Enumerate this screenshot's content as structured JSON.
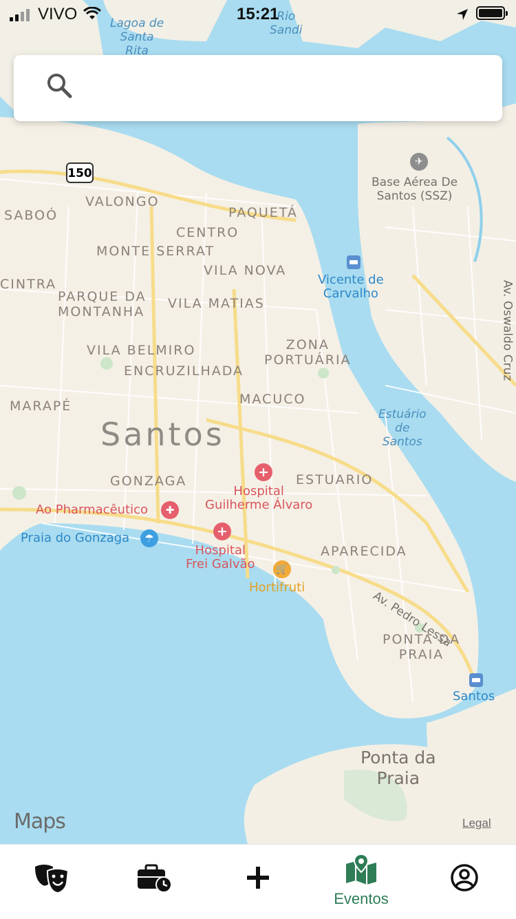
{
  "status_bar": {
    "carrier": "VIVO",
    "time": "15:21"
  },
  "search": {
    "placeholder": "",
    "value": ""
  },
  "map": {
    "city_label": "Santos",
    "route_shield": "150",
    "districts": [
      "VALONGO",
      "SABOÓ",
      "PAQUETÁ",
      "CENTRO",
      "MONTE SERRAT",
      "VILA NOVA",
      "CINTRA",
      "PARQUE DA",
      "MONTANHA",
      "VILA MATIAS",
      "VILA BELMIRO",
      "ZONA",
      "PORTUÁRIA",
      "ENCRUZILHADA",
      "MARAPÉ",
      "MACUCO",
      "GONZAGA",
      "ESTUARIO",
      "APARECIDA",
      "PONTA DA",
      "PRAIA"
    ],
    "water": [
      "Lagoa de",
      "Santa",
      "Rita",
      "Rio",
      "Sandi",
      "Estuário",
      "de",
      "Santos"
    ],
    "airbase": [
      "Base Aérea De",
      "Santos (SSZ)"
    ],
    "ferry_1": [
      "Vicente de",
      "Carvalho"
    ],
    "ferry_2": "Santos",
    "street_1": "Av. Oswaldo Cruz",
    "street_2": "Av. Pedro Lessa",
    "hospital_1": [
      "Hospital",
      "Guilherme Álvaro"
    ],
    "hospital_2": [
      "Hospital",
      "Frei Galvão"
    ],
    "pharmacy": "Ao Pharmacêutico",
    "beach": "Praia do Gonzaga",
    "market": "Hortifruti",
    "island": [
      "Ponta da",
      "Praia"
    ],
    "attribution": "Maps",
    "legal": "Legal"
  },
  "tabs": [
    {
      "icon": "theater-masks-icon",
      "label": ""
    },
    {
      "icon": "briefcase-clock-icon",
      "label": ""
    },
    {
      "icon": "plus-icon",
      "label": ""
    },
    {
      "icon": "map-pin-icon",
      "label": "Eventos",
      "active": true
    },
    {
      "icon": "user-circle-icon",
      "label": ""
    }
  ],
  "colors": {
    "accent": "#2e7d57",
    "water": "#a9dcf0",
    "land": "#f5f0e6"
  }
}
